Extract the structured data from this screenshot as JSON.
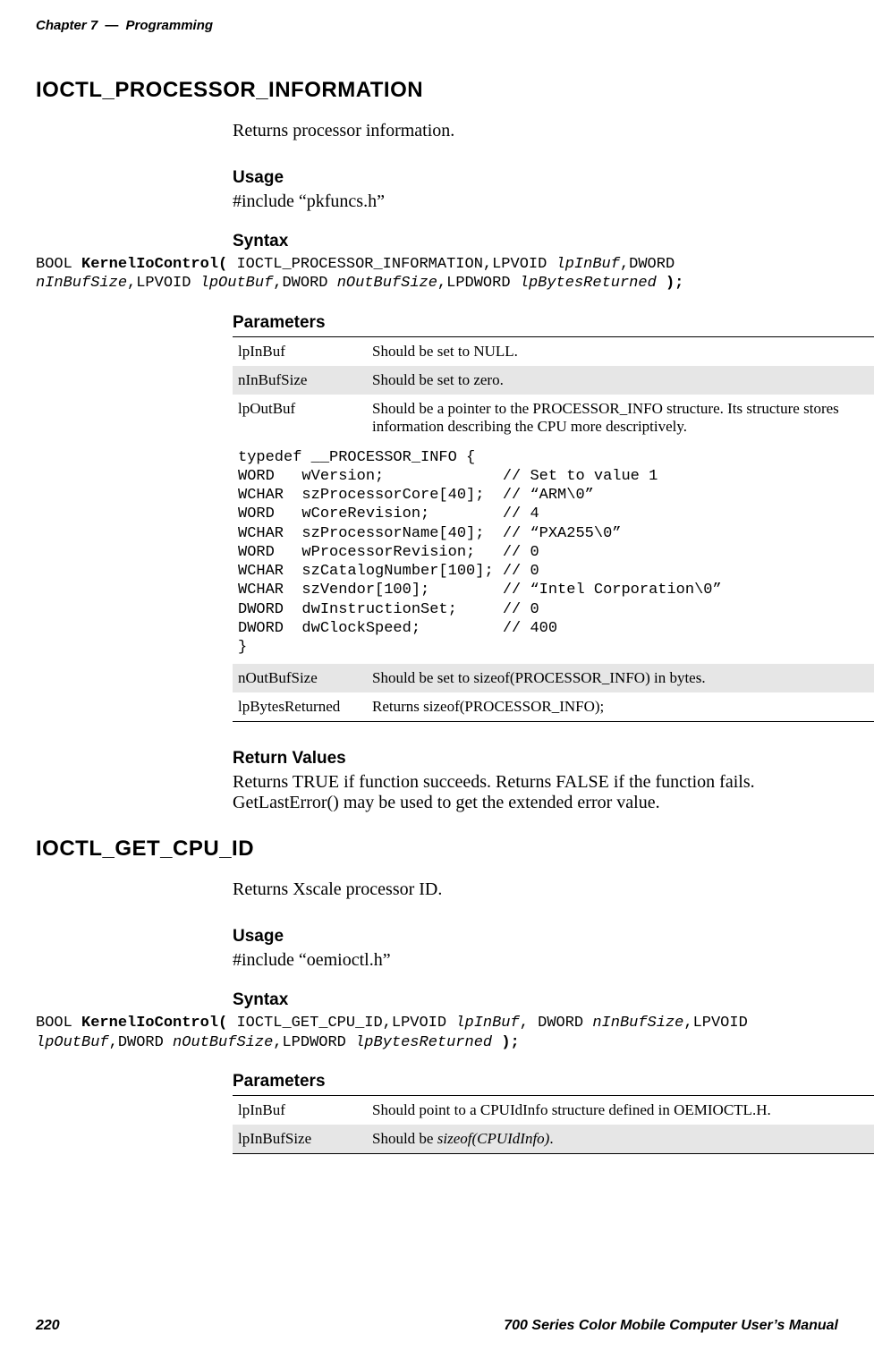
{
  "header": {
    "chapter": "Chapter 7",
    "sep": "—",
    "section": "Programming"
  },
  "section1": {
    "title": "IOCTL_PROCESSOR_INFORMATION",
    "desc": "Returns processor information.",
    "usage_h": "Usage",
    "usage_line": "#include “pkfuncs.h”",
    "syntax_h": "Syntax",
    "syntax_pre1": "BOOL ",
    "syntax_bold1": "KernelIoControl(",
    "syntax_plain1": " IOCTL_PROCESSOR_INFORMATION,LPVOID ",
    "syntax_ital1": "lpInBuf",
    "syntax_plain2": ",DWORD",
    "syntax_ital2": "nInBufSize",
    "syntax_plain3": ",LPVOID ",
    "syntax_ital3": "lpOutBuf",
    "syntax_plain4": ",DWORD ",
    "syntax_ital4": "nOutBufSize",
    "syntax_plain5": ",LPDWORD ",
    "syntax_ital5": "lpBytesReturned",
    "syntax_plain6": " ",
    "syntax_bold2": ");",
    "params_h": "Parameters",
    "params": {
      "r1a": "lpInBuf",
      "r1b": "Should be set to NULL.",
      "r2a": "nInBufSize",
      "r2b": "Should be set to zero.",
      "r3a": "lpOutBuf",
      "r3b": "Should be a pointer to the PROCESSOR_INFO structure. Its structure stores information describing the CPU more descriptively.",
      "r4a": "nOutBufSize",
      "r4b": "Should be set to sizeof(PROCESSOR_INFO) in bytes.",
      "r5a": "lpBytesReturned",
      "r5b": "Returns sizeof(PROCESSOR_INFO);"
    },
    "struct_code": "typedef __PROCESSOR_INFO {\nWORD   wVersion;             // Set to value 1\nWCHAR  szProcessorCore[40];  // “ARM\\0”\nWORD   wCoreRevision;        // 4\nWCHAR  szProcessorName[40];  // “PXA255\\0”\nWORD   wProcessorRevision;   // 0\nWCHAR  szCatalogNumber[100]; // 0\nWCHAR  szVendor[100];        // “Intel Corporation\\0”\nDWORD  dwInstructionSet;     // 0\nDWORD  dwClockSpeed;         // 400\n}",
    "return_h": "Return Values",
    "return_body": "Returns TRUE if function succeeds. Returns FALSE if the function fails. GetLastError() may be used to get the extended error value."
  },
  "section2": {
    "title": "IOCTL_GET_CPU_ID",
    "desc": "Returns Xscale processor ID.",
    "usage_h": "Usage",
    "usage_line": "#include “oemioctl.h”",
    "syntax_h": "Syntax",
    "syntax_pre1": "BOOL ",
    "syntax_bold1": "KernelIoControl(",
    "syntax_plain1": " IOCTL_GET_CPU_ID,LPVOID ",
    "syntax_ital1": "lpInBuf",
    "syntax_plain2": ", DWORD ",
    "syntax_ital2": "nInBufSize",
    "syntax_plain3": ",LPVOID",
    "syntax_ital3": "lpOutBuf",
    "syntax_plain4": ",DWORD ",
    "syntax_ital4": "nOutBufSize",
    "syntax_plain5": ",LPDWORD ",
    "syntax_ital5": "lpBytesReturned",
    "syntax_plain6": " ",
    "syntax_bold2": ");",
    "params_h": "Parameters",
    "params": {
      "r1a": "lpInBuf",
      "r1b": "Should point to a CPUIdInfo structure defined in OEMIOCTL.H.",
      "r2a": "lpInBufSize",
      "r2b_pre": "Should be ",
      "r2b_ital": "sizeof(CPUIdInfo)",
      "r2b_post": "."
    }
  },
  "footer": {
    "page_no": "220",
    "manual": "700 Series Color Mobile Computer User’s Manual"
  }
}
